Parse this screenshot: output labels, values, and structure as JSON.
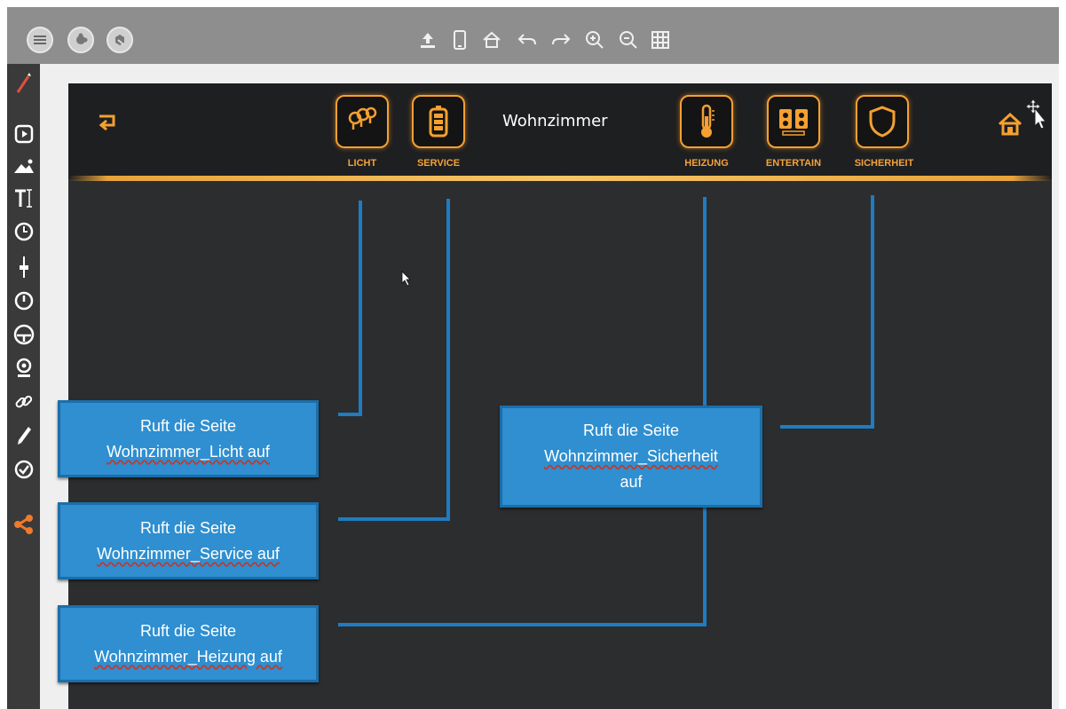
{
  "toolbar": {
    "left_buttons": [
      {
        "icon": "menu-icon"
      },
      {
        "icon": "plugin-icon"
      },
      {
        "icon": "extensions-icon"
      }
    ],
    "center_icons": [
      "upload-icon",
      "phone-icon",
      "home-icon",
      "undo-icon",
      "redo-icon",
      "zoom-in-icon",
      "zoom-out-icon",
      "grid-icon"
    ]
  },
  "sidebar": {
    "icons": [
      "magic-wand-icon",
      "play-icon",
      "image-icon",
      "text-icon",
      "clock-icon",
      "slider-icon",
      "timer-icon",
      "gauge-icon",
      "webcam-icon",
      "link-icon",
      "pen-icon",
      "check-circle-icon",
      "share-icon"
    ]
  },
  "visualization": {
    "room_title": "Wohnzimmer",
    "nav_buttons": [
      {
        "label": "LICHT",
        "icon": "bulbs-icon"
      },
      {
        "label": "SERVICE",
        "icon": "battery-icon"
      },
      {
        "label": "HEIZUNG",
        "icon": "thermometer-icon"
      },
      {
        "label": "ENTERTAIN",
        "icon": "speakers-icon"
      },
      {
        "label": "SICHERHEIT",
        "icon": "shield-icon"
      }
    ],
    "back_icon": "back-arrow-icon",
    "home_icon": "home-icon",
    "accent": "#f5a030"
  },
  "callouts": [
    {
      "line1": "Ruft die Seite",
      "line2": "Wohnzimmer_Licht auf",
      "line3": ""
    },
    {
      "line1": "Ruft die Seite",
      "line2": "Wohnzimmer_Service auf",
      "line3": ""
    },
    {
      "line1": "Ruft die Seite",
      "line2": "Wohnzimmer_Heizung auf",
      "line3": ""
    },
    {
      "line1": "Ruft die Seite",
      "line2": "Wohnzimmer_Sicherheit",
      "line3": "auf"
    }
  ],
  "colors": {
    "callout_bg": "#2f8fd0",
    "connector": "#1f7cc0",
    "canvas_bg": "#2c2d2f"
  }
}
